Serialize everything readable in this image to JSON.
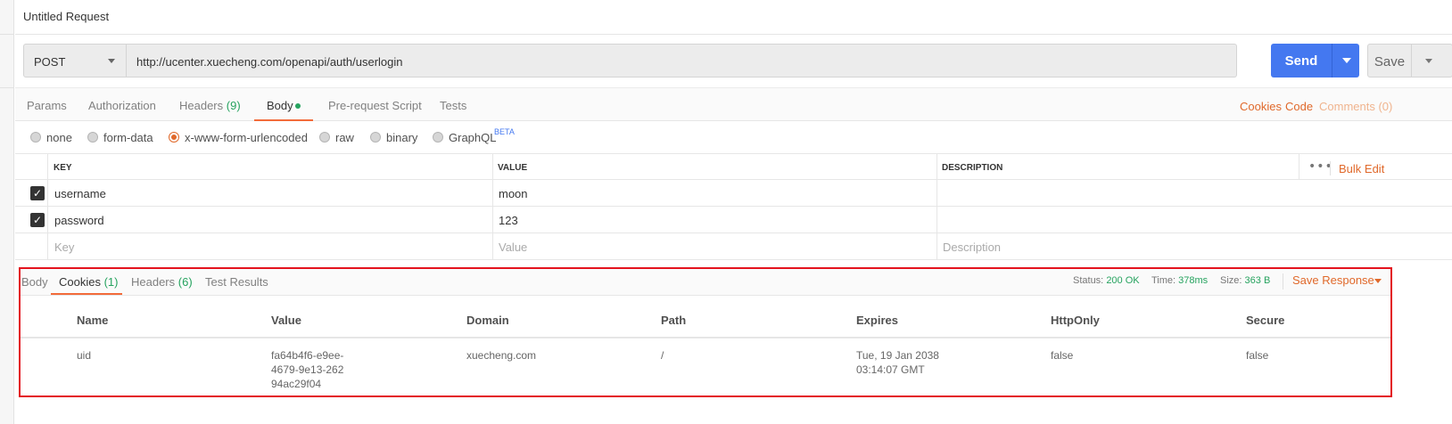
{
  "tab_title": "Untitled Request",
  "request": {
    "method": "POST",
    "url": "http://ucenter.xuecheng.com/openapi/auth/userlogin",
    "send_label": "Send",
    "save_label": "Save"
  },
  "request_tabs": [
    {
      "label": "Params"
    },
    {
      "label": "Authorization"
    },
    {
      "label": "Headers",
      "count": "(9)"
    },
    {
      "label": "Body",
      "active": true,
      "has_dot": true
    },
    {
      "label": "Pre-request Script"
    },
    {
      "label": "Tests"
    }
  ],
  "right_links": {
    "cookies": "Cookies",
    "code": "Code",
    "comments": "Comments (0)"
  },
  "body_modes": [
    {
      "label": "none",
      "selected": false
    },
    {
      "label": "form-data",
      "selected": false
    },
    {
      "label": "x-www-form-urlencoded",
      "selected": true
    },
    {
      "label": "raw",
      "selected": false
    },
    {
      "label": "binary",
      "selected": false
    },
    {
      "label": "GraphQL",
      "selected": false,
      "badge": "BETA"
    }
  ],
  "kv_table": {
    "headers": {
      "key": "KEY",
      "value": "VALUE",
      "description": "DESCRIPTION"
    },
    "more_icon": "more-dots-icon",
    "bulk_edit": "Bulk Edit",
    "rows": [
      {
        "checked": true,
        "key": "username",
        "value": "moon",
        "description": ""
      },
      {
        "checked": true,
        "key": "password",
        "value": "123",
        "description": ""
      }
    ],
    "placeholder": {
      "key": "Key",
      "value": "Value",
      "description": "Description"
    }
  },
  "response": {
    "tabs": [
      {
        "label": "Body"
      },
      {
        "label": "Cookies",
        "count": "(1)",
        "active": true
      },
      {
        "label": "Headers",
        "count": "(6)"
      },
      {
        "label": "Test Results"
      }
    ],
    "status_label": "Status:",
    "status_value": "200 OK",
    "time_label": "Time:",
    "time_value": "378ms",
    "size_label": "Size:",
    "size_value": "363 B",
    "save_response": "Save Response",
    "cookie_columns": [
      "Name",
      "Value",
      "Domain",
      "Path",
      "Expires",
      "HttpOnly",
      "Secure"
    ],
    "cookies": [
      {
        "name": "uid",
        "value": "fa64b4f6-e9ee-4679-9e13-26294ac29f04",
        "domain": "xuecheng.com",
        "path": "/",
        "expires": "Tue, 19 Jan 2038 03:14:07 GMT",
        "http_only": "false",
        "secure": "false"
      }
    ]
  },
  "colors": {
    "accent": "#e0692b",
    "send": "#4478f0",
    "success": "#26a35f",
    "highlight_box": "#e3131d"
  }
}
